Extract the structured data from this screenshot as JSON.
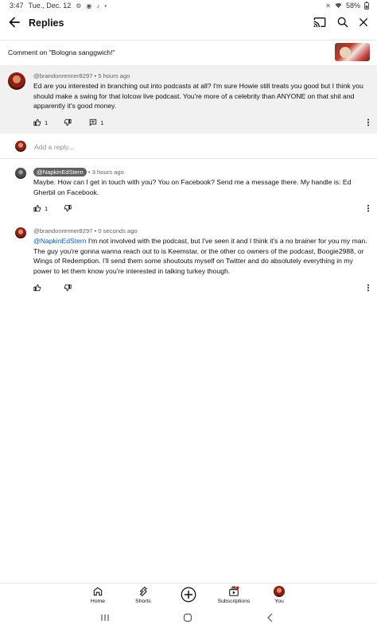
{
  "status_bar": {
    "time": "3:47",
    "date": "Tue., Dec. 12",
    "battery": "58%",
    "icons_left": [
      "settings-icon",
      "messenger-icon",
      "tiktok-icon",
      "dot-icon"
    ],
    "icons_right": [
      "mute-icon",
      "wifi-icon",
      "battery-icon"
    ]
  },
  "app_bar": {
    "title": "Replies",
    "icons": [
      "back-arrow-icon",
      "cast-icon",
      "search-icon",
      "close-icon"
    ]
  },
  "context": {
    "label": "Comment on \"Bologna sanggwich!\""
  },
  "parent_comment": {
    "author": "@brandonrenner8297",
    "time": "5 hours ago",
    "text": "Ed are you interested in branching out into podcasts at all? I'm sure Howie still treats you good but I think you should make a swing for that lolcow live podcast. You're more of a celebrity than ANYONE on that shit and apparently it's good money.",
    "likes": "1",
    "replies": "1"
  },
  "add_reply": {
    "placeholder": "Add a reply..."
  },
  "replies": [
    {
      "author": "@NapkinEdStern",
      "time": "3 hours ago",
      "text": "Maybe. How can I get in touch with  you? You on Facebook? Send me a message there. My handle is: Ed Gherbil on Facebook.",
      "likes": "1"
    },
    {
      "author": "@brandonrenner8297",
      "time": "0 seconds ago",
      "mention": "@NapkinEdStern",
      "text": " I'm not involved with the podcast, but I've seen it and I think it's a no brainer for you my man. The guy you're gonna wanna reach out to is Keemstar, or the other co owners of the podcast, Boogie2988, or Wings of Redemption. I'll send them some shoutouts myself on Twitter and do absolutely everything in my power to let them know you're interested in talking turkey though.",
      "likes": ""
    }
  ],
  "bottom_nav": {
    "items": [
      {
        "label": "Home",
        "icon": "home-icon"
      },
      {
        "label": "Shorts",
        "icon": "shorts-icon"
      },
      {
        "label": "",
        "icon": "create-icon"
      },
      {
        "label": "Subscriptions",
        "icon": "subscriptions-icon"
      },
      {
        "label": "You",
        "icon": "avatar-icon"
      }
    ]
  },
  "system_nav": {
    "icons": [
      "recents-icon",
      "home-circle-icon",
      "back-chevron-icon"
    ]
  },
  "colors": {
    "highlight_bg": "#f1f1f1",
    "mention": "#065fd4",
    "notification_dot": "#ff0000"
  }
}
